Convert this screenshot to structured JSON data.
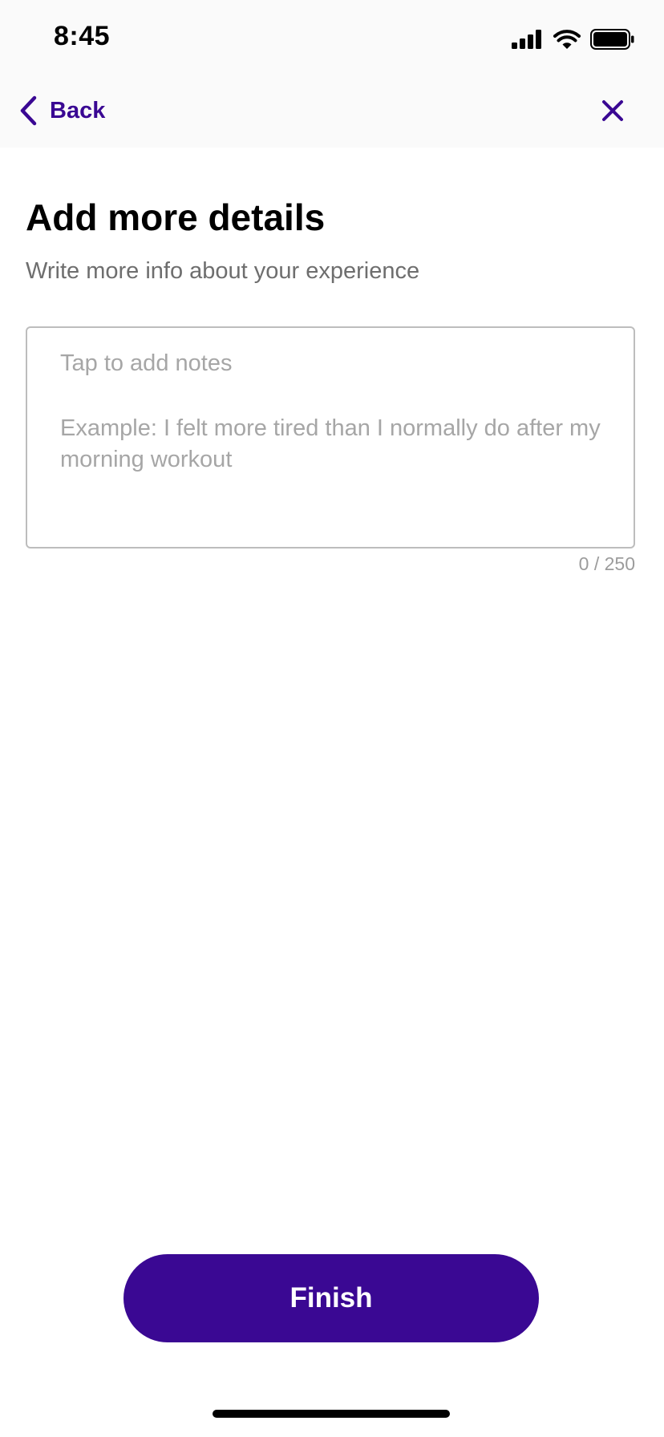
{
  "status_bar": {
    "time": "8:45",
    "icons": [
      "cellular-signal-icon",
      "wifi-icon",
      "battery-icon"
    ]
  },
  "nav": {
    "back_label": "Back",
    "back_icon": "chevron-left-icon",
    "close_icon": "close-icon"
  },
  "content": {
    "title": "Add more details",
    "subtitle": "Write more info about your experience",
    "notes": {
      "prompt": "Tap to add notes",
      "example": "Example: I felt more tired than I normally do after my morning workout",
      "counter": "0 / 250"
    }
  },
  "footer": {
    "finish_label": "Finish"
  },
  "colors": {
    "accent": "#3a0893",
    "placeholder": "#a6a6a6",
    "subtitle": "#6e6e6e",
    "border": "#bdbdbd"
  }
}
